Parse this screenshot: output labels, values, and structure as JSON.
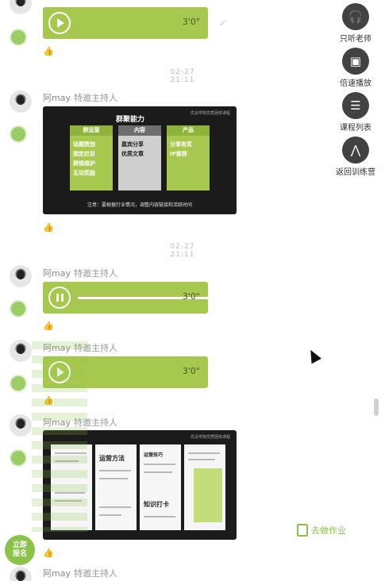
{
  "messages": [
    {
      "sender": "阿may",
      "role": "特邀主持人",
      "duration": "3'0\"",
      "playing": false
    },
    {
      "sender": "阿may",
      "role": "特邀主持人"
    },
    {
      "sender": "阿may",
      "role": "特邀主持人",
      "duration": "3'0\"",
      "playing": true,
      "progress": 0.95
    },
    {
      "sender": "阿may",
      "role": "特邀主持人",
      "duration": "3'0\""
    },
    {
      "sender": "阿may",
      "role": "特邀主持人"
    },
    {
      "sender": "阿may",
      "role": "特邀主持人"
    }
  ],
  "timestamps": [
    "02-27 21:11",
    "02-27 21:11"
  ],
  "slide1": {
    "title": "群聚能力",
    "logo": "优设学院优质团体课程",
    "columns": [
      {
        "head": "群运营",
        "items": [
          "话题策划",
          "固定栏目",
          "群规维护",
          "互动奖励"
        ]
      },
      {
        "head": "内容",
        "items": [
          "嘉宾分享",
          "优质文章"
        ]
      },
      {
        "head": "产品",
        "items": [
          "分享有奖",
          "IP推荐"
        ]
      }
    ],
    "note": "注意：要根据行业情况，调整内容链接和活跃时间"
  },
  "slide2": {
    "logo": "优设学院优质团体课程",
    "page_titles": [
      "运营方法",
      "运营技巧",
      "知识打卡"
    ]
  },
  "side_menu": [
    {
      "icon": "headphones-icon",
      "glyph": "🎧",
      "label": "只听老师"
    },
    {
      "icon": "frame-icon",
      "glyph": "▣",
      "label": "倍速播放"
    },
    {
      "icon": "list-icon",
      "glyph": "☰",
      "label": "课程列表"
    },
    {
      "icon": "back-icon",
      "glyph": "⋀",
      "label": "返回训练营"
    }
  ],
  "homework": "去做作业",
  "floating_badge": "立即\n报名",
  "colors": {
    "accent": "#a7c84e",
    "dark": "#1b1b1b"
  }
}
